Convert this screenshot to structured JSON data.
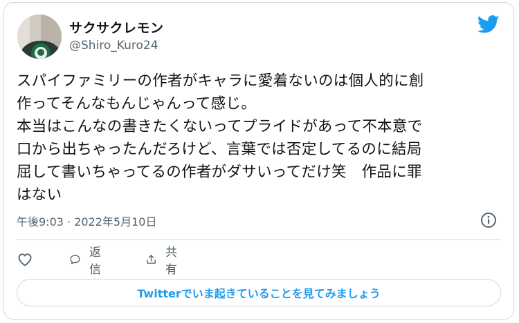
{
  "user": {
    "display_name": "サクサクレモン",
    "handle": "@Shiro_Kuro24",
    "avatar_icon": "avatar-photo"
  },
  "brand": {
    "logo_icon": "twitter-bird-icon",
    "color": "#1d9bf0"
  },
  "tweet": {
    "lines": [
      "スパイファミリーの作者がキャラに愛着ないのは個人的に創",
      "作ってそんなもんじゃんって感じ。",
      "本当はこんなの書きたくないってプライドがあって不本意で",
      "口から出ちゃったんだろけど、言葉では否定してるのに結局",
      "屈して書いちゃってるの作者がダサいってだけ笑　作品に罪",
      "はない"
    ],
    "timestamp": "午後9:03 · 2022年5月10日"
  },
  "actions": {
    "like_icon": "heart-icon",
    "reply_icon": "speech-bubble-icon",
    "reply_label": "返信",
    "share_icon": "share-icon",
    "share_label": "共有"
  },
  "cta": {
    "label": "Twitterでいま起きていることを見てみましょう"
  }
}
